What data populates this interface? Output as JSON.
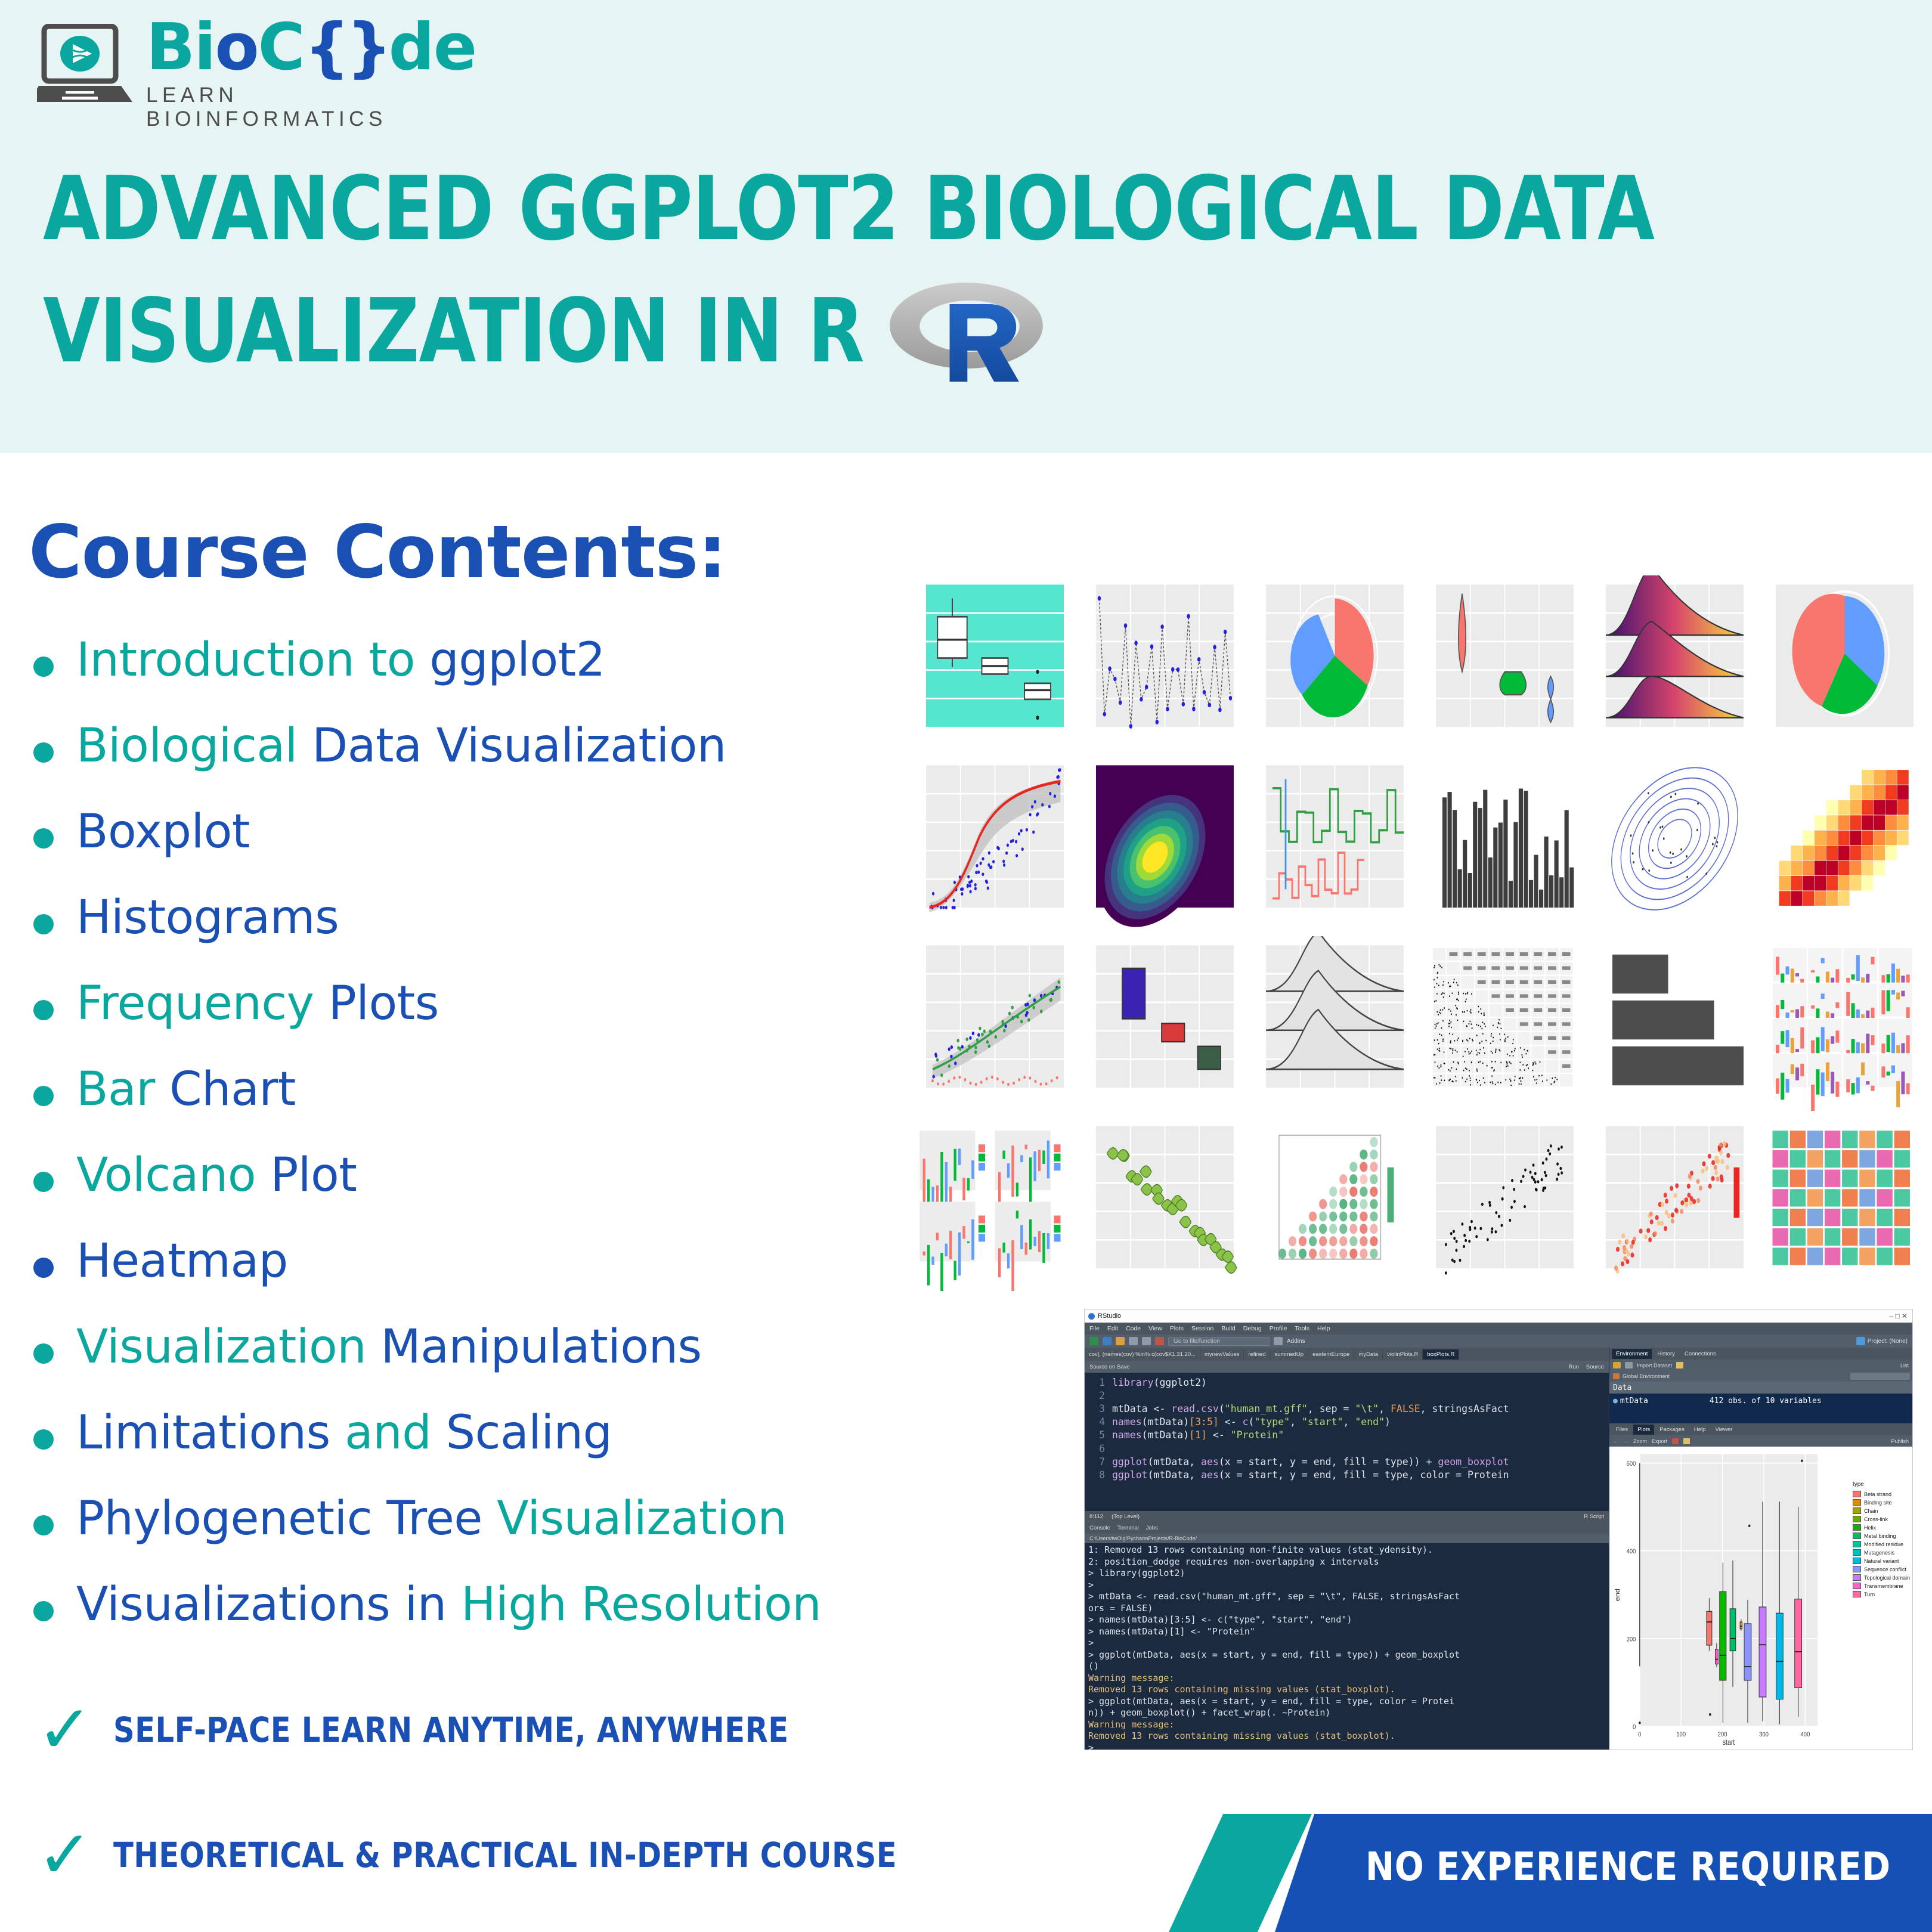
{
  "brand": {
    "name_bio": "Bi",
    "name_o": "o",
    "name_c": "C",
    "name_de": "de",
    "tagline": "LEARN BIOINFORMATICS"
  },
  "header": {
    "title_line1": "ADVANCED GGPLOT2 BIOLOGICAL DATA",
    "title_line2": "VISUALIZATION IN R",
    "r_logo_letter": "R"
  },
  "contents": {
    "heading": "Course Contents:",
    "items": [
      {
        "green": "Introduction to ",
        "blue": "ggplot2"
      },
      {
        "green": "Biological ",
        "blue": "Data Visualization"
      },
      {
        "green": "",
        "blue": "Boxplot"
      },
      {
        "green": "",
        "blue": "Histograms"
      },
      {
        "green": "Frequency ",
        "blue": "Plots"
      },
      {
        "green": "Bar ",
        "blue": "Chart"
      },
      {
        "green": "Volcano ",
        "blue": "Plot"
      },
      {
        "green": "",
        "blue": "Heatmap"
      },
      {
        "green": "Visualization ",
        "blue": "Manipulations"
      },
      {
        "green": "",
        "blue": "Limitations",
        "green2": " and ",
        "blue2": "Scaling"
      },
      {
        "green": "",
        "blue": "Phylogenetic Tree ",
        "green2": "Visualization"
      },
      {
        "green": "",
        "blue": "Visualizations in ",
        "green2": "High Resolution"
      }
    ]
  },
  "checks": [
    {
      "mark": "✓",
      "label": "SELF-PACE LEARN ANYTIME, ANYWHERE"
    },
    {
      "mark": "✓",
      "label": "THEORETICAL & PRACTICAL IN-DEPTH COURSE"
    }
  ],
  "banner": {
    "label": "NO EXPERIENCE REQUIRED"
  },
  "colors": {
    "teal": "#0aa79f",
    "blue": "#1a50b4",
    "header_bg": "#e6f5f4",
    "banner_blue": "#1550b4"
  },
  "rstudio": {
    "window_title": "RStudio",
    "menu": [
      "File",
      "Edit",
      "Code",
      "View",
      "Plots",
      "Session",
      "Build",
      "Debug",
      "Profile",
      "Tools",
      "Help"
    ],
    "toolbar_search_placeholder": "Go to file/function",
    "toolbar_addins": "Addins",
    "project_label": "Project: (None)",
    "editor_tabs": [
      "cov[, (names(cov) %in% c(cov$X1.31.20...",
      "mynewValues",
      "refined",
      "summedUp",
      "easternEurope",
      "myData",
      "violinPlots.R",
      "boxPlots.R"
    ],
    "editor_tab_active": "boxPlots.R",
    "source_on_save": "Source on Save",
    "run_label": "Run",
    "source_label": "Source",
    "editor_lines": [
      {
        "n": "1",
        "code": "library(ggplot2)"
      },
      {
        "n": "2",
        "code": ""
      },
      {
        "n": "3",
        "code": "mtData <- read.csv(\"human_mt.gff\", sep = \"\\t\", FALSE, stringsAsFact"
      },
      {
        "n": "4",
        "code": "names(mtData)[3:5] <- c(\"type\", \"start\", \"end\")"
      },
      {
        "n": "5",
        "code": "names(mtData)[1] <- \"Protein\""
      },
      {
        "n": "6",
        "code": ""
      },
      {
        "n": "7",
        "code": "ggplot(mtData, aes(x = start, y = end, fill = type)) + geom_boxplot"
      },
      {
        "n": "8",
        "code": "ggplot(mtData, aes(x = start, y = end, fill = type, color = Protein"
      }
    ],
    "status_position": "8:112",
    "status_scope": "(Top Level)",
    "status_type": "R Script",
    "console_tabs": [
      "Console",
      "Terminal",
      "Jobs"
    ],
    "console_path": "C:/Users/twOig/PycharmProjects/R-BioCode/",
    "console_lines": [
      {
        "t": "1: Removed 13 rows containing non-finite values (stat_ydensity)."
      },
      {
        "t": "2: position_dodge requires non-overlapping x intervals"
      },
      {
        "t": "> library(ggplot2)"
      },
      {
        "t": "> "
      },
      {
        "t": "> mtData <- read.csv(\"human_mt.gff\", sep = \"\\t\", FALSE, stringsAsFact"
      },
      {
        "t": "ors = FALSE)"
      },
      {
        "t": "> names(mtData)[3:5] <- c(\"type\", \"start\", \"end\")"
      },
      {
        "t": "> names(mtData)[1] <- \"Protein\""
      },
      {
        "t": "> "
      },
      {
        "t": "> ggplot(mtData, aes(x = start, y = end, fill = type)) + geom_boxplot"
      },
      {
        "t": "()"
      },
      {
        "t": "Warning message:",
        "warn": true
      },
      {
        "t": "Removed 13 rows containing missing values (stat_boxplot).",
        "warn": true
      },
      {
        "t": "> ggplot(mtData, aes(x = start, y = end, fill = type, color = Protei"
      },
      {
        "t": "n)) + geom_boxplot() + facet_wrap(. ~Protein)"
      },
      {
        "t": "Warning message:",
        "warn": true
      },
      {
        "t": "Removed 13 rows containing missing values (stat_boxplot).",
        "warn": true
      },
      {
        "t": "> "
      }
    ],
    "env_tabs": [
      "Environment",
      "History",
      "Connections"
    ],
    "env_import": "Import Dataset",
    "env_list": "List",
    "env_global": "Global Environment",
    "env_section": "Data",
    "env_var_name": "mtData",
    "env_var_desc": "412 obs. of 10 variables",
    "plot_tabs": [
      "Files",
      "Plots",
      "Packages",
      "Help",
      "Viewer"
    ],
    "plot_zoom": "Zoom",
    "plot_export": "Export",
    "plot_publish": "Publish"
  },
  "chart_data": {
    "type": "boxplot",
    "title": "",
    "xlabel": "start",
    "ylabel": "end",
    "legend_title": "type",
    "xticks": [
      "0",
      "100",
      "200",
      "300",
      "400"
    ],
    "yticks": [
      "0",
      "200",
      "400",
      "600"
    ],
    "ylim": [
      0,
      620
    ],
    "xlim": [
      0,
      430
    ],
    "legend": [
      {
        "label": "Beta strand",
        "color": "#f8766d"
      },
      {
        "label": "Binding site",
        "color": "#d89000"
      },
      {
        "label": "Chain",
        "color": "#a3a500"
      },
      {
        "label": "Cross-link",
        "color": "#71a800"
      },
      {
        "label": "Helix",
        "color": "#0cb702"
      },
      {
        "label": "Metal binding",
        "color": "#00be67"
      },
      {
        "label": "Modified residue",
        "color": "#00c19a"
      },
      {
        "label": "Mutagenesis",
        "color": "#00bfc4"
      },
      {
        "label": "Natural variant",
        "color": "#00b8e7"
      },
      {
        "label": "Sequence conflict",
        "color": "#8b93ff"
      },
      {
        "label": "Topological domain",
        "color": "#c77cff"
      },
      {
        "label": "Transmembrane",
        "color": "#ff61cc"
      },
      {
        "label": "Turn",
        "color": "#ff68a1"
      }
    ],
    "boxes": [
      {
        "name": "Beta strand",
        "color": "#f8766d",
        "x": 168,
        "w": 13,
        "q1": 185,
        "med": 238,
        "q3": 262,
        "lo": 172,
        "hi": 292
      },
      {
        "name": "Transmembrane",
        "color": "#ff61cc",
        "x": 186,
        "w": 7,
        "q1": 142,
        "med": 153,
        "q3": 176,
        "lo": 135,
        "hi": 190
      },
      {
        "name": "Helix",
        "color": "#0cb702",
        "x": 201,
        "w": 16,
        "q1": 105,
        "med": 162,
        "q3": 307,
        "lo": 8,
        "hi": 373
      },
      {
        "name": "Metal binding",
        "color": "#00be67",
        "x": 225,
        "w": 14,
        "q1": 172,
        "med": 200,
        "q3": 268,
        "lo": 90,
        "hi": 378
      },
      {
        "name": "Binding site",
        "color": "#d89000",
        "x": 245,
        "w": 5,
        "q1": 222,
        "med": 228,
        "q3": 238,
        "lo": 218,
        "hi": 244
      },
      {
        "name": "Sequence conflict",
        "color": "#8b93ff",
        "x": 261,
        "w": 17,
        "q1": 105,
        "med": 136,
        "q3": 234,
        "lo": 8,
        "hi": 288
      },
      {
        "name": "Topological domain",
        "color": "#c77cff",
        "x": 297,
        "w": 17,
        "q1": 67,
        "med": 186,
        "q3": 272,
        "lo": 12,
        "hi": 512
      },
      {
        "name": "Natural variant",
        "color": "#00b8e7",
        "x": 338,
        "w": 17,
        "q1": 62,
        "med": 148,
        "q3": 258,
        "lo": 5,
        "hi": 512
      },
      {
        "name": "Turn",
        "color": "#ff68a1",
        "x": 383,
        "w": 17,
        "q1": 88,
        "med": 170,
        "q3": 290,
        "lo": 22,
        "hi": 500
      }
    ],
    "outliers": [
      {
        "x": 0,
        "y": 8
      },
      {
        "x": 170,
        "y": 27
      },
      {
        "x": 265,
        "y": 457
      },
      {
        "x": 392,
        "y": 605
      }
    ],
    "tall_line": {
      "x": 0,
      "lo": 137,
      "hi": 600
    }
  },
  "plot_grid": {
    "cells": [
      "boxplot-teal",
      "scatter-line",
      "rose-polar",
      "violin",
      "ridgeline-gradient",
      "pie-polar",
      "scatter-loess",
      "density-contour-filled",
      "step-line",
      "histogram-black",
      "contour-lines",
      "heatmap-tiles",
      "scatter-smooth",
      "boxplot-three",
      "ridgeline-grey",
      "pairs-matrix",
      "bar-horizontal",
      "pairs-color",
      "bar-small-facets",
      "leaf-scatter",
      "correlogram",
      "scatter-bw",
      "scatter-red",
      "tile-grid"
    ]
  }
}
